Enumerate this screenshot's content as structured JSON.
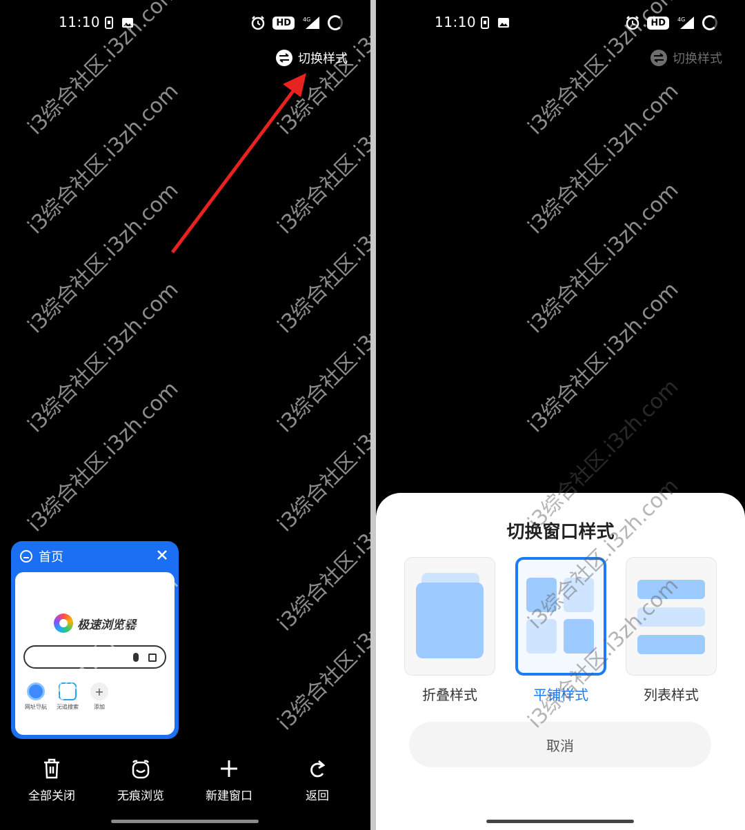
{
  "left_screen": {
    "status_bar": {
      "time": "11:10",
      "hd_label": "HD",
      "network_label": "4G"
    },
    "switch_style_label": "切换样式",
    "tab_card": {
      "title": "首页",
      "browser_name": "极速浏览器",
      "shortcuts": [
        {
          "label": "网址导航",
          "icon": "compass-icon"
        },
        {
          "label": "无追搜索",
          "icon": "shield-icon"
        },
        {
          "label": "添加",
          "icon": "plus-icon",
          "glyph": "+"
        }
      ]
    },
    "toolbar": {
      "close_all": "全部关闭",
      "incognito": "无痕浏览",
      "new_window": "新建窗口",
      "back": "返回"
    }
  },
  "right_screen": {
    "status_bar": {
      "time": "11:10",
      "hd_label": "HD",
      "network_label": "4G"
    },
    "switch_style_label": "切换样式",
    "sheet": {
      "title": "切换窗口样式",
      "options": [
        {
          "label": "折叠样式",
          "selected": false
        },
        {
          "label": "平铺样式",
          "selected": true
        },
        {
          "label": "列表样式",
          "selected": false
        }
      ],
      "cancel": "取消"
    }
  },
  "watermark": "i3综合社区.i3zh.com",
  "colors": {
    "accent": "#1b7cf5",
    "tab_card": "#1b6ff2",
    "arrow": "#e8231f",
    "tile": "#9ecbff"
  }
}
